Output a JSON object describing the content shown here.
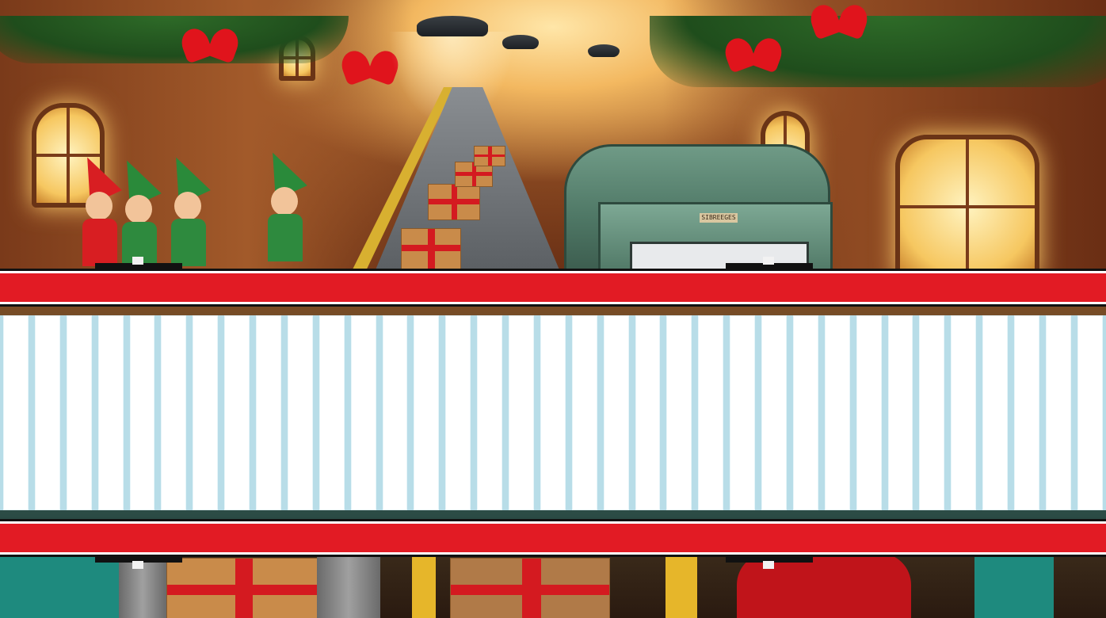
{
  "scene": {
    "theme": "santa-workshop-conveyor",
    "machine_plate_text": "SIBREEGES"
  },
  "reels": {
    "count": 35
  },
  "colors": {
    "bar_red": "#e21b24",
    "reel_bg": "#ffffff",
    "reel_border": "#b8dde8",
    "tab": "#111111"
  }
}
